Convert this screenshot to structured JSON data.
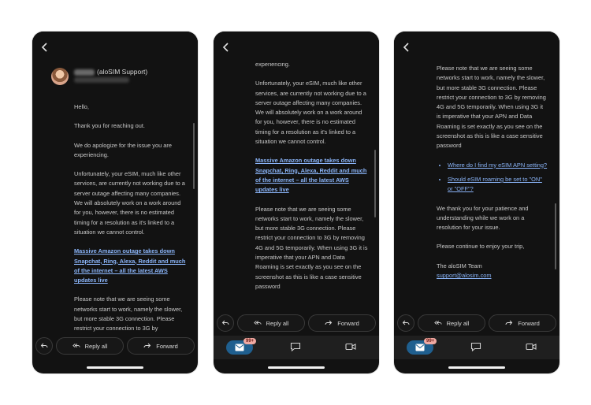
{
  "colors": {
    "background": "#121212",
    "link": "#8ab4f8",
    "badge": "#f0a9a2",
    "nav_active": "#1f5f8f"
  },
  "toolbar_icons": [
    "back-arrow-icon",
    "archive-icon",
    "trash-icon",
    "mark-unread-icon",
    "more-icon"
  ],
  "email": {
    "sender_suffix": "(aloSIM Support)",
    "greeting": "Hello,",
    "thanks": "Thank you for reaching out.",
    "apology": "We do apologize for the issue you are experiencing.",
    "outage_p1": "Unfortunately, your eSIM, much like other services, are currently not working due to a server outage affecting many companies. We will absolutely work on a work around for you, however, there is no estimated timing for a resolution as it's linked to a situation we cannot control.",
    "outage_p2": "Unfortunately, your eSIM, much like other services, are currently not working due to a server outage affecting many companies. We will absolutely work on a work around for you, however, there is no estimated timing for a resolution as it's linked to a situation we cannot control.",
    "news_link": "Massive Amazon outage takes down Snapchat, Ring, Alexa, Reddit and much of the internet – all the latest AWS updates live",
    "network_note": "Please note that we are seeing some networks start to work, namely the slower, but more stable 3G connection. Please restrict your connection to 3G by removing 4G and 5G temporarily. When using 3G it is imperative that your APN and Data Roaming is set exactly as you see on the screenshot as this is like a case sensitive password",
    "network_note_p3": "Please note that we are seeing some networks start to work, namely the slower, but more stable 3G connection. Please restrict your connection to 3G by removing 4G and 5G temporarily. When using 3G it is imperative that your APN and Data Roaming is set exactly as you see on the screenshot as this is like a case sensitive password",
    "network_note_partial": "Please note that we are seeing some networks start to work, namely the slower, but more stable 3G connection. Please restrict your connection to 3G by",
    "experiencing": "experiencing.",
    "faq_links": [
      "Where do I find my eSIM APN setting?",
      "Should eSIM roaming be set to \"ON\" or \"OFF\"?"
    ],
    "closing_thanks": "We thank you for your patience and understanding while we work on a resolution for your issue.",
    "enjoy": "Please continue to enjoy your trip,",
    "signature": "The aloSIM Team",
    "support_email": "support@alosim.com"
  },
  "reply_bar": {
    "reply_all": "Reply all",
    "forward": "Forward"
  },
  "nav": {
    "badge": "99+"
  }
}
